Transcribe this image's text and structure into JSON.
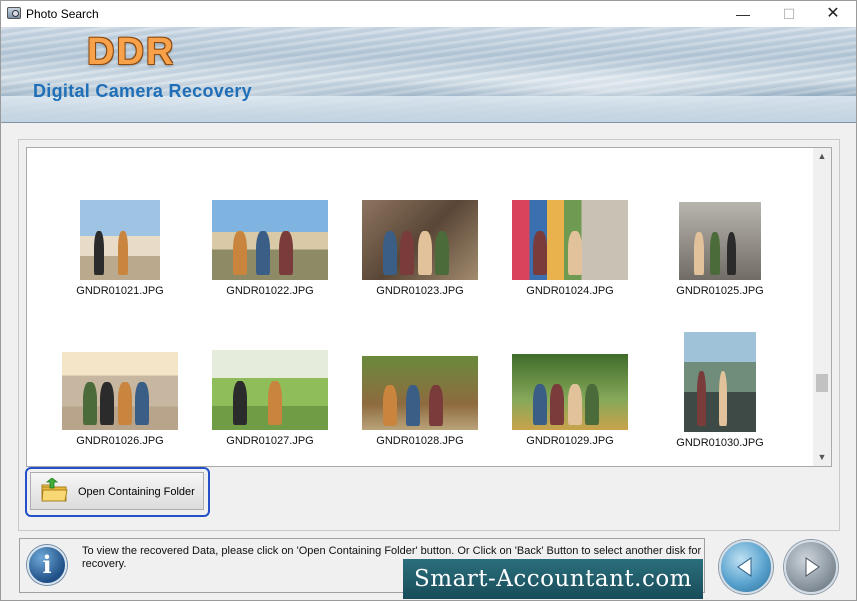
{
  "window": {
    "title": "Photo Search",
    "controls": {
      "minimize": "—",
      "maximize": "☐",
      "close": "✕"
    }
  },
  "banner": {
    "logo": "DDR",
    "subtitle": "Digital Camera Recovery"
  },
  "gallery": {
    "photos": [
      {
        "filename": "GNDR01021.JPG",
        "style": "sky1"
      },
      {
        "filename": "GNDR01022.JPG",
        "style": "sky2"
      },
      {
        "filename": "GNDR01023.JPG",
        "style": "rock"
      },
      {
        "filename": "GNDR01024.JPG",
        "style": "market"
      },
      {
        "filename": "GNDR01025.JPG",
        "style": "street"
      },
      {
        "filename": "GNDR01026.JPG",
        "style": "bus"
      },
      {
        "filename": "GNDR01027.JPG",
        "style": "park"
      },
      {
        "filename": "GNDR01028.JPG",
        "style": "forest"
      },
      {
        "filename": "GNDR01029.JPG",
        "style": "forest2"
      },
      {
        "filename": "GNDR01030.JPG",
        "style": "crowd"
      }
    ]
  },
  "actions": {
    "open_folder_label": "Open Containing Folder"
  },
  "status": {
    "message": "To view the recovered Data, please click on 'Open Containing Folder' button. Or Click on 'Back' Button to select another disk for recovery.",
    "watermark": "Smart-Accountant.com"
  },
  "icons": {
    "app": "camera-icon",
    "folder": "folder-icon",
    "info": "info-icon",
    "back": "back-arrow-icon",
    "next": "next-arrow-icon"
  },
  "colors": {
    "accent_blue": "#1f6fb8",
    "logo_orange": "#f7a24a",
    "focus_outline": "#2450c8"
  }
}
